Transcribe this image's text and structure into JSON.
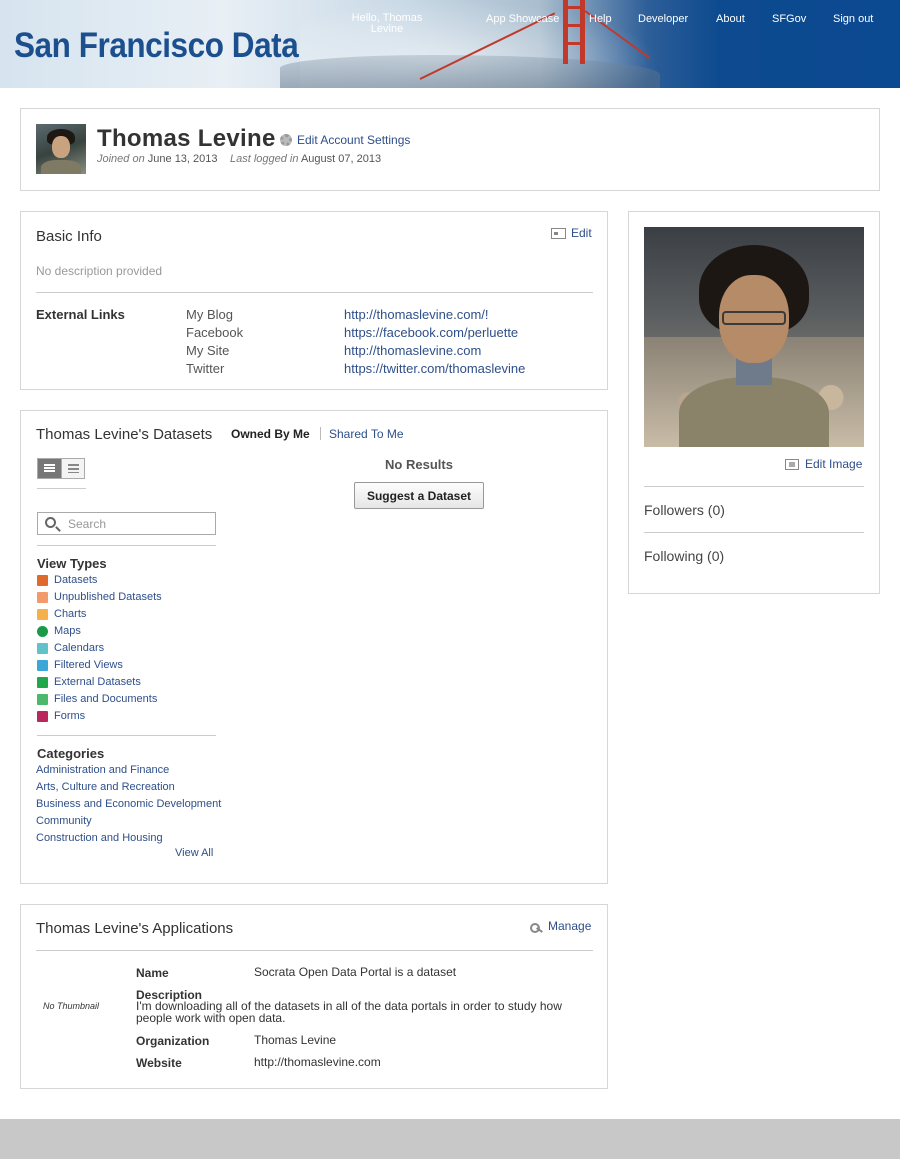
{
  "header": {
    "brand": "San Francisco Data",
    "greeting": "Hello, Thomas Levine",
    "nav": [
      "App Showcase",
      "Help",
      "Developer",
      "About",
      "SFGov",
      "Sign out"
    ]
  },
  "profile": {
    "name": "Thomas Levine",
    "edit_account_label": "Edit Account Settings",
    "joined_label": "Joined on",
    "joined_date": "June 13, 2013",
    "last_logged_label": "Last logged in",
    "last_logged_date": "August 07, 2013"
  },
  "basic_info": {
    "title": "Basic Info",
    "edit_label": "Edit",
    "description": "No description provided",
    "external_links_label": "External Links",
    "links": [
      {
        "name": "My Blog",
        "url": "http://thomaslevine.com/!"
      },
      {
        "name": "Facebook",
        "url": "https://facebook.com/perluette"
      },
      {
        "name": "My Site",
        "url": "http://thomaslevine.com"
      },
      {
        "name": "Twitter",
        "url": "https://twitter.com/thomaslevine"
      }
    ]
  },
  "datasets": {
    "title": "Thomas Levine's Datasets",
    "tabs": [
      "Owned By Me",
      "Shared To Me"
    ],
    "search_placeholder": "Search",
    "view_types_label": "View Types",
    "view_types": [
      {
        "label": "Datasets",
        "color": "#e06a2c",
        "icon": "dataset-icon"
      },
      {
        "label": "Unpublished Datasets",
        "color": "#f29a6b",
        "icon": "unpublished-dataset-icon"
      },
      {
        "label": "Charts",
        "color": "#f5b04a",
        "icon": "chart-icon"
      },
      {
        "label": "Maps",
        "color": "#1a9a48",
        "icon": "map-icon"
      },
      {
        "label": "Calendars",
        "color": "#5fc3c9",
        "icon": "calendar-icon"
      },
      {
        "label": "Filtered Views",
        "color": "#3aa7d8",
        "icon": "filter-icon"
      },
      {
        "label": "External Datasets",
        "color": "#1fa84a",
        "icon": "external-dataset-icon"
      },
      {
        "label": "Files and Documents",
        "color": "#4cb86c",
        "icon": "file-icon"
      },
      {
        "label": "Forms",
        "color": "#b8285e",
        "icon": "form-icon"
      }
    ],
    "categories_label": "Categories",
    "categories": [
      "Administration and Finance",
      "Arts, Culture and Recreation",
      "Business and Economic Development",
      "Community",
      "Construction and Housing"
    ],
    "view_all_label": "View All",
    "no_results": "No Results",
    "suggest_label": "Suggest a Dataset"
  },
  "applications": {
    "title": "Thomas Levine's Applications",
    "manage_label": "Manage",
    "no_thumbnail": "No Thumbnail",
    "name_label": "Name",
    "name_value": "Socrata Open Data Portal is a dataset",
    "description_label": "Description",
    "description_value": "I'm downloading all of the datasets in all of the data portals in order to study how people work with open data.",
    "organization_label": "Organization",
    "organization_value": "Thomas Levine",
    "website_label": "Website",
    "website_value": "http://thomaslevine.com"
  },
  "sidebar": {
    "edit_image_label": "Edit Image",
    "followers": "Followers (0)",
    "following": "Following (0)"
  }
}
